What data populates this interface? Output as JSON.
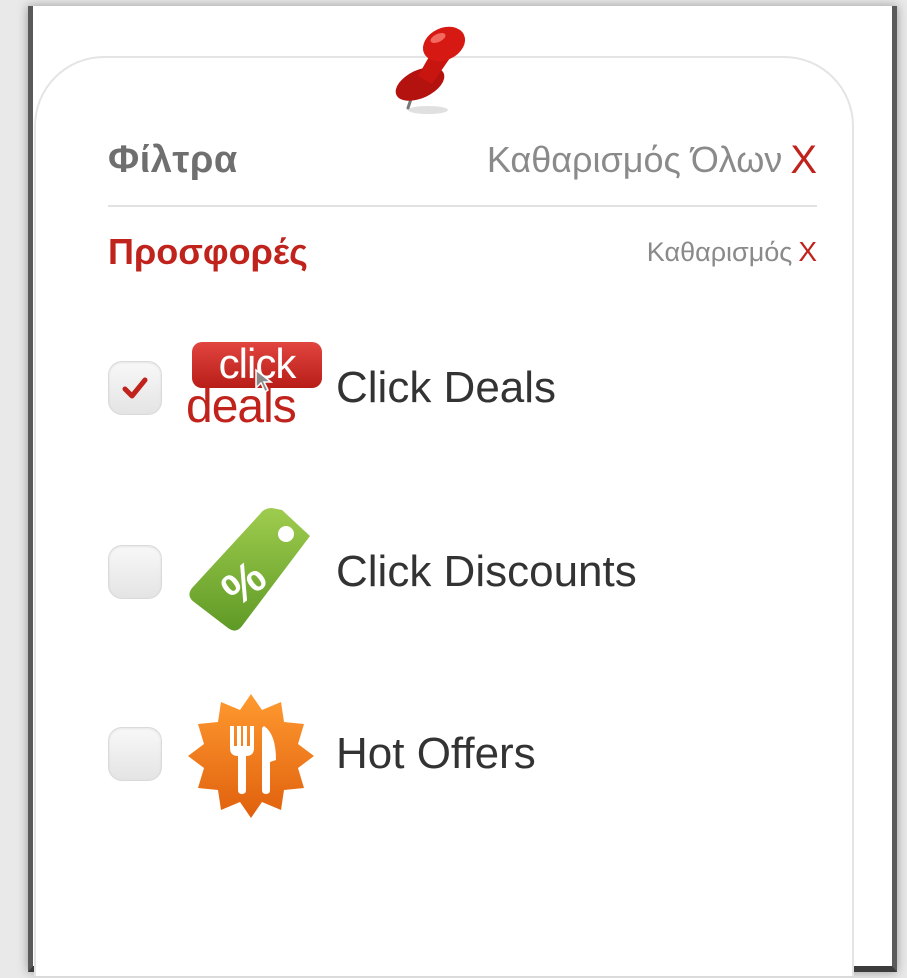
{
  "header": {
    "title": "Φίλτρα",
    "clear_all_label": "Καθαρισμός Όλων",
    "clear_all_x": "X"
  },
  "section": {
    "title": "Προσφορές",
    "clear_label": "Καθαρισμός",
    "clear_x": "X"
  },
  "options": [
    {
      "label": "Click Deals",
      "checked": true,
      "icon": "click-deals-logo",
      "logo_top": "click",
      "logo_bottom": "deals"
    },
    {
      "label": "Click Discounts",
      "checked": false,
      "icon": "discount-tag-icon",
      "tag_symbol": "%"
    },
    {
      "label": "Hot Offers",
      "checked": false,
      "icon": "fork-knife-badge-icon"
    }
  ],
  "colors": {
    "accent_red": "#c0221c",
    "tag_green": "#7fb13a",
    "badge_orange": "#f07b1a"
  },
  "decorations": {
    "pin_icon": "push-pin-icon"
  }
}
